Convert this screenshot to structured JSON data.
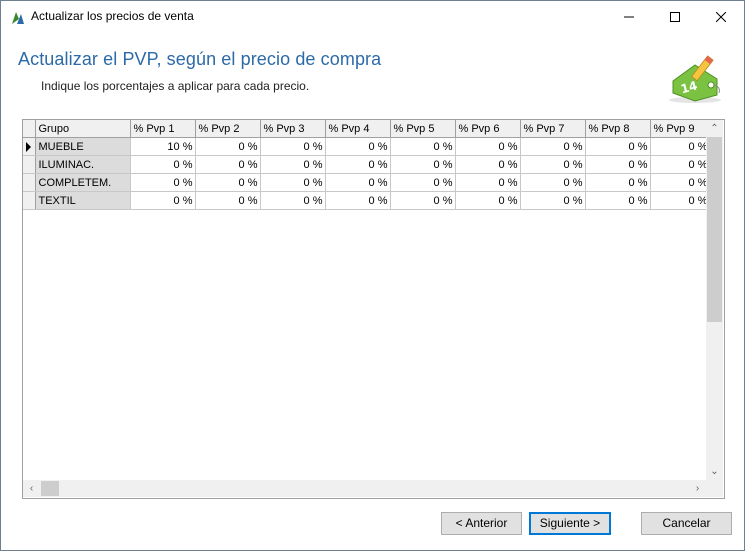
{
  "window": {
    "title": "Actualizar los precios de venta"
  },
  "header": {
    "title": "Actualizar el PVP, según el precio de compra",
    "subtitle": "Indique los porcentajes a aplicar para cada precio."
  },
  "grid": {
    "columns": [
      "Grupo",
      "% Pvp 1",
      "% Pvp 2",
      "% Pvp 3",
      "% Pvp 4",
      "% Pvp 5",
      "% Pvp 6",
      "% Pvp 7",
      "% Pvp 8",
      "% Pvp 9"
    ],
    "rows": [
      {
        "grupo": "MUEBLE",
        "values": [
          "10 %",
          "0 %",
          "0 %",
          "0 %",
          "0 %",
          "0 %",
          "0 %",
          "0 %",
          "0 %"
        ],
        "current": true
      },
      {
        "grupo": "ILUMINAC.",
        "values": [
          "0 %",
          "0 %",
          "0 %",
          "0 %",
          "0 %",
          "0 %",
          "0 %",
          "0 %",
          "0 %"
        ],
        "current": false
      },
      {
        "grupo": "COMPLETEM.",
        "values": [
          "0 %",
          "0 %",
          "0 %",
          "0 %",
          "0 %",
          "0 %",
          "0 %",
          "0 %",
          "0 %"
        ],
        "current": false
      },
      {
        "grupo": "TEXTIL",
        "values": [
          "0 %",
          "0 %",
          "0 %",
          "0 %",
          "0 %",
          "0 %",
          "0 %",
          "0 %",
          "0 %"
        ],
        "current": false
      }
    ]
  },
  "buttons": {
    "prev": "< Anterior",
    "next": "Siguiente >",
    "cancel": "Cancelar"
  },
  "icons": {
    "app": "app-logo-icon",
    "wizard": "price-tag-edit-icon"
  }
}
